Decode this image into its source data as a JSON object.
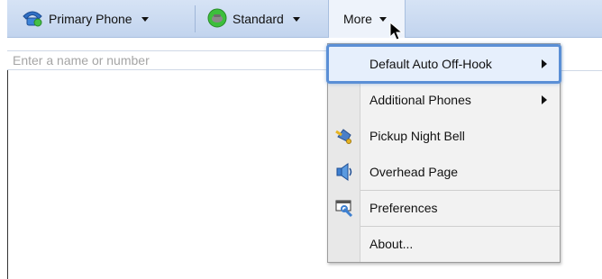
{
  "toolbar": {
    "primary_phone": "Primary Phone",
    "standard": "Standard",
    "more": "More"
  },
  "search": {
    "placeholder": "Enter a name or number"
  },
  "menu": {
    "items": [
      {
        "label": "Default Auto Off-Hook",
        "submenu": true,
        "highlighted": true
      },
      {
        "label": "Additional Phones",
        "submenu": true
      },
      {
        "label": "Pickup Night Bell",
        "icon": "bell-icon"
      },
      {
        "label": "Overhead Page",
        "icon": "speaker-icon"
      },
      {
        "label": "Preferences",
        "icon": "preferences-icon"
      },
      {
        "label": "About..."
      }
    ]
  },
  "colors": {
    "toolbar_bg": "#c8d8f0",
    "highlight_border": "#5a8fd6",
    "status_green": "#3cbf3c"
  }
}
